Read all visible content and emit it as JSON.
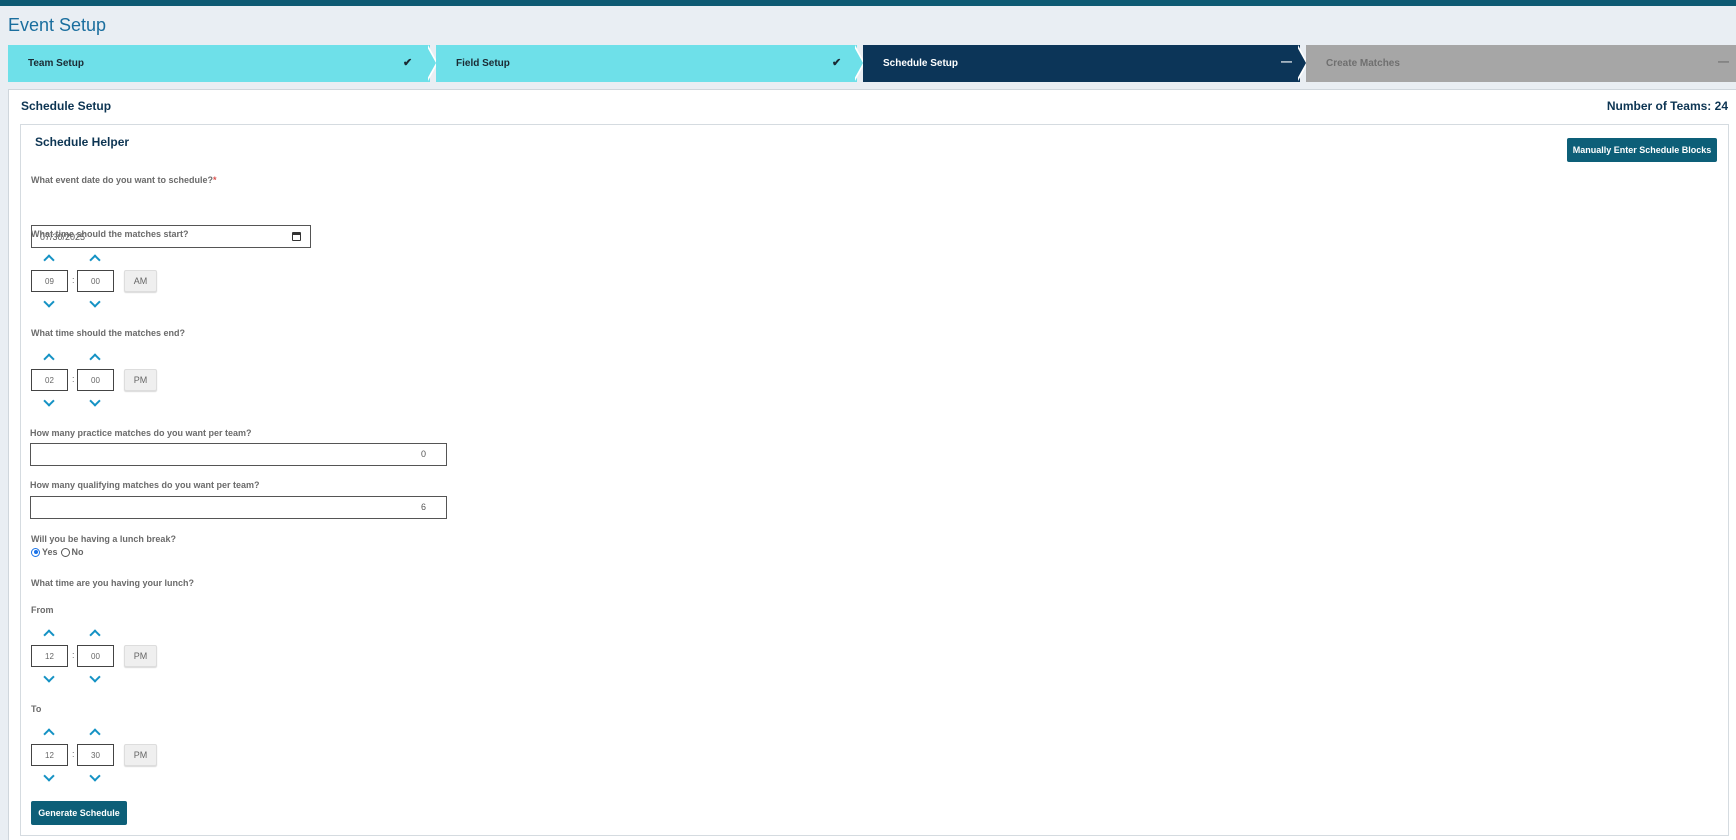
{
  "page": {
    "title": "Event Setup"
  },
  "wizard": {
    "steps": [
      {
        "label": "Team Setup",
        "mark": "✔",
        "state": "done"
      },
      {
        "label": "Field Setup",
        "mark": "✔",
        "state": "done"
      },
      {
        "label": "Schedule Setup",
        "mark": "—",
        "state": "active"
      },
      {
        "label": "Create Matches",
        "mark": "—",
        "state": "pending"
      }
    ]
  },
  "card": {
    "title": "Schedule Setup",
    "team_count": "Number of Teams: 24"
  },
  "helper": {
    "title": "Schedule Helper",
    "manual_button": "Manually Enter Schedule Blocks",
    "date_question": "What event date do you want to schedule?",
    "required_mark": "*",
    "date_value": "07/30/2025",
    "start_question": "What time should the matches start?",
    "start": {
      "hour": "09",
      "minute": "00",
      "meridiem": "AM"
    },
    "end_question": "What time should the matches end?",
    "end": {
      "hour": "02",
      "minute": "00",
      "meridiem": "PM"
    },
    "practice_question": "How many practice matches do you want per team?",
    "practice_value": "0",
    "qualifying_question": "How many qualifying matches do you want per team?",
    "qualifying_value": "6",
    "lunch_question": "Will you be having a lunch break?",
    "lunch_yes": "Yes",
    "lunch_no": "No",
    "lunch_selected": "Yes",
    "lunch_time_question": "What time are you having your lunch?",
    "from_label": "From",
    "lunch_from": {
      "hour": "12",
      "minute": "00",
      "meridiem": "PM"
    },
    "to_label": "To",
    "lunch_to": {
      "hour": "12",
      "minute": "30",
      "meridiem": "PM"
    },
    "generate_button": "Generate Schedule",
    "colon": ":"
  },
  "colors": {
    "step_done": "#6ee0e9",
    "step_active": "#0c3558",
    "step_pending": "#a6a6a6",
    "button": "#0d5f78",
    "arrow_accent": "#1592c4"
  }
}
